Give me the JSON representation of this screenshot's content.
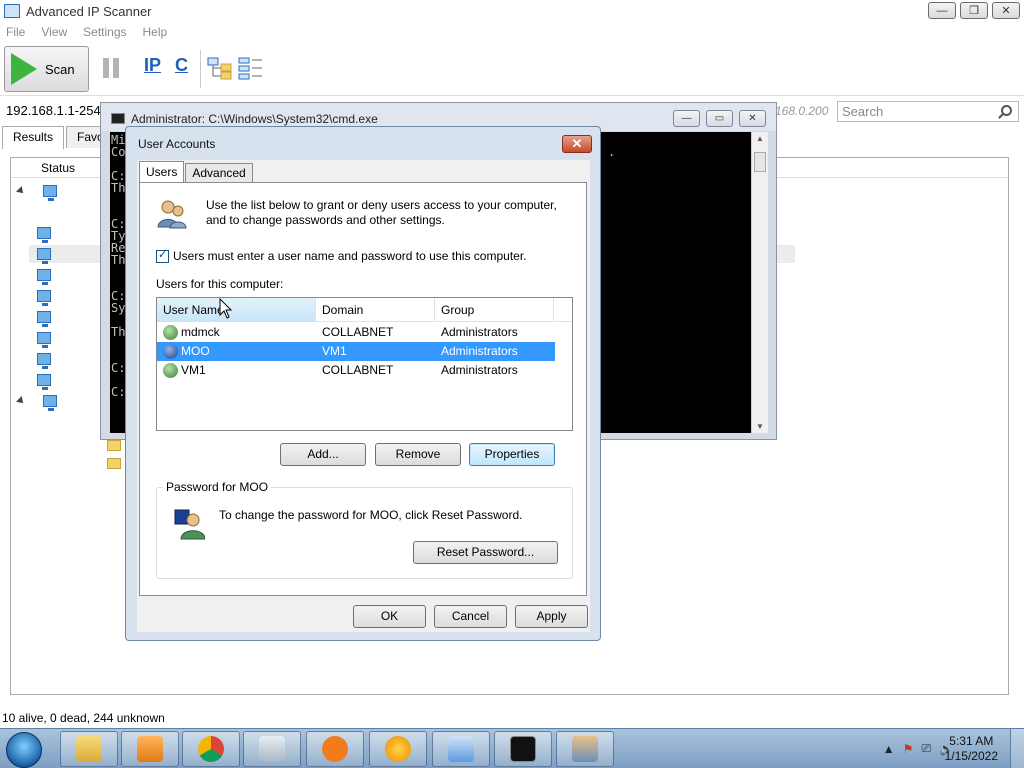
{
  "app": {
    "title": "Advanced IP Scanner",
    "menu": [
      "File",
      "View",
      "Settings",
      "Help"
    ],
    "scan_label": "Scan",
    "toolbar_ip": "IP",
    "toolbar_c": "C",
    "ip_range": "192.168.1.1-254",
    "ip_range_end": "168.0.200",
    "search_placeholder": "Search",
    "tabs": [
      "Results",
      "Favo"
    ],
    "status_column": "Status",
    "status_bar": "10 alive, 0 dead, 244 unknown"
  },
  "cmd": {
    "title": "Administrator: C:\\Windows\\System32\\cmd.exe",
    "lines": [
      "Mi",
      "Co",
      "",
      "C:",
      "Th",
      "",
      "",
      "C:",
      "Ty",
      "Re",
      "Th",
      "",
      "",
      "C:",
      "Sy",
      "",
      "Th",
      "",
      "",
      "C:",
      "",
      "C:"
    ],
    "right_char": "."
  },
  "dialog": {
    "title": "User Accounts",
    "close": "✕",
    "tabs": [
      "Users",
      "Advanced"
    ],
    "intro": "Use the list below to grant or deny users access to your computer, and to change passwords and other settings.",
    "checkbox_label": "Users must enter a user name and password to use this computer.",
    "list_caption": "Users for this computer:",
    "columns": [
      "User Name",
      "Domain",
      "Group"
    ],
    "users": [
      {
        "name": "mdmck",
        "domain": "COLLABNET",
        "group": "Administrators"
      },
      {
        "name": "MOO",
        "domain": "VM1",
        "group": "Administrators"
      },
      {
        "name": "VM1",
        "domain": "COLLABNET",
        "group": "Administrators"
      }
    ],
    "buttons": {
      "add": "Add...",
      "remove": "Remove",
      "properties": "Properties"
    },
    "password_group": "Password for MOO",
    "password_text": "To change the password for MOO, click Reset Password.",
    "reset_password": "Reset Password...",
    "ok": "OK",
    "cancel": "Cancel",
    "apply": "Apply"
  },
  "taskbar": {
    "time": "5:31 AM",
    "date": "1/15/2022",
    "tray_arrow": "▲"
  }
}
